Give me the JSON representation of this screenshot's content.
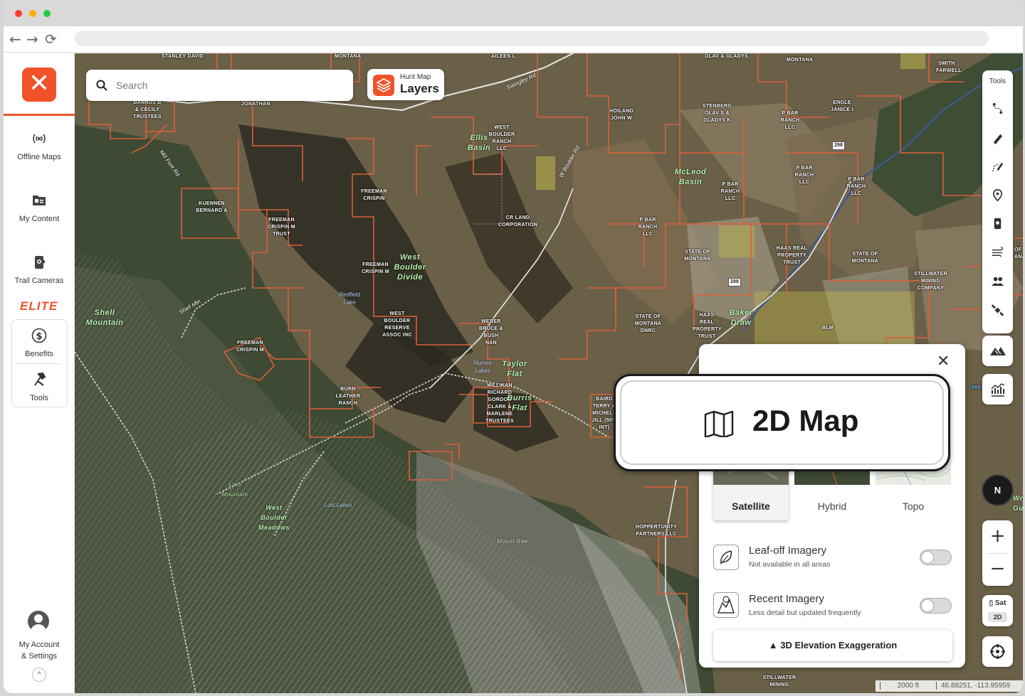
{
  "sidebar": {
    "items": [
      {
        "label": "Offline Maps",
        "icon": "offline-maps-icon"
      },
      {
        "label": "My Content",
        "icon": "folder-icon"
      },
      {
        "label": "Trail Cameras",
        "icon": "trail-camera-icon"
      }
    ],
    "elite_label": "ELITE",
    "elite_items": [
      {
        "label": "Benefits",
        "icon": "dollar-icon"
      },
      {
        "label": "Tools",
        "icon": "tools-icon"
      }
    ],
    "account_label_line1": "My Account",
    "account_label_line2": "& Settings"
  },
  "search": {
    "placeholder": "Search"
  },
  "layers": {
    "sub": "Hunt Map",
    "main": "Layers"
  },
  "tools": {
    "title": "Tools"
  },
  "map_labels": {
    "parcels": [
      "STANLEY DAVID",
      "MONTANA",
      "AILEEN L",
      "OLAV & GLADYS",
      "MONTANA",
      "SMITH FARWELL",
      "BANNUS B & CECILY TRUSTEES",
      "JONATHAN",
      "HOILAND JOHN W",
      "STENBERG OLAV S & GLADYS K",
      "P BAR RANCH LLC",
      "ENGLE JANICE I",
      "WEST BOULDER RANCH LLC",
      "FREEMAN CRISPIN",
      "KUENNEN BERNARD A",
      "FREEMAN CRISPIN M TRUST",
      "CR LAND CORPORATION",
      "P BAR RANCH LLC",
      "P BAR RANCH LLC",
      "P BAR RANCH LLC",
      "P BAR RANCH LLC",
      "STATE OF MONTANA",
      "HAAS REAL PROPERTY TRUST",
      "STATE OF MONTANA",
      "STILLWATER MINING COMPANY",
      "FREEMAN CRISPIN M",
      "WEST BOULDER RESERVE ASSOC INC",
      "WEBER BRUCE & BUSH NAN",
      "STATE OF MONTANA DNRC",
      "HAAS REAL PROPERTY TRUST",
      "BLM",
      "FREEMAN CRISPIN M",
      "BURN LEATHER RANCH",
      "MILLIKAN RICHARD GORDON CLARK & MARLENE TRUSTEES",
      "BAIRD TERRY & MICHELS JILL (50% INT)",
      "HOPPERTUNITY PARTNERS LLC",
      "STILLWATER MINING"
    ],
    "places": [
      "Ellis Basin",
      "McLeod Basin",
      "West Boulder Divide",
      "Shell Mountain",
      "Taylor Flat",
      "Burris Flat",
      "Baker Draw",
      "West Boulder Meadows",
      "Lion Mountain",
      "Mount Rae"
    ],
    "water": [
      "Redfield Lake",
      "Nurses Lakes",
      "Lost Lakes"
    ],
    "roads": [
      "Swingley Rd",
      "W Boulder Rd",
      "Shell Mtn",
      "Mill Fork Rd"
    ],
    "shields": [
      "298",
      "298"
    ]
  },
  "panel": {
    "basemaps": [
      "Satellite",
      "Hybrid",
      "Topo"
    ],
    "selected_basemap": "Satellite",
    "options": [
      {
        "title": "Leaf-off Imagery",
        "subtitle": "Not available in all areas",
        "icon": "leaf-icon",
        "enabled": false
      },
      {
        "title": "Recent Imagery",
        "subtitle": "Less detail but updated frequently",
        "icon": "recent-imagery-icon",
        "enabled": false
      }
    ],
    "elevation_button": "3D Elevation Exaggeration"
  },
  "callout": {
    "label": "2D Map",
    "icon": "map-icon"
  },
  "map_controls": {
    "compass": "N",
    "zoom_in": "+",
    "zoom_out": "−",
    "basemap_indicator": "Sat",
    "mode_indicator": "2D",
    "edge_number": "560",
    "edge_text": [
      "OF",
      "ANA",
      "Wr",
      "Gu"
    ]
  },
  "status": {
    "scale": "2000 ft",
    "coords": "46.88251, -113.95959"
  },
  "colors": {
    "accent": "#f0522a",
    "parcel_line": "#d9603a",
    "public_land": "#c2b84a"
  }
}
